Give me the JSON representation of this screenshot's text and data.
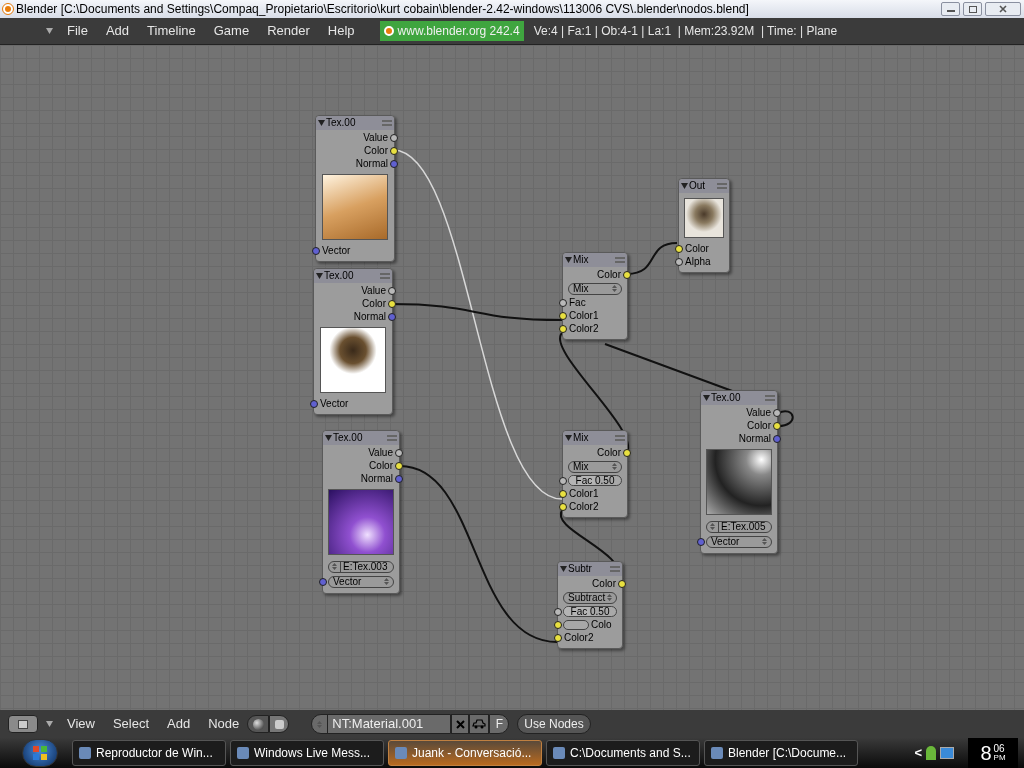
{
  "window": {
    "title": "Blender [C:\\Documents and Settings\\Compaq_Propietario\\Escritorio\\kurt cobain\\blender-2.42-windows\\113006 CVS\\.blender\\nodos.blend]"
  },
  "menu": [
    "File",
    "Add",
    "Timeline",
    "Game",
    "Render",
    "Help"
  ],
  "version_badge": "www.blender.org 242.4",
  "stats": "Ve:4 | Fa:1 | Ob:4-1 | La:1  | Mem:23.92M  | Time: | Plane",
  "nodes": [
    {
      "title": "Tex.00",
      "rows": [
        {
          "kind": "output",
          "label": "Value",
          "color": "#b8b8b8"
        },
        {
          "kind": "output",
          "label": "Color",
          "color": "#e8e040"
        },
        {
          "kind": "output",
          "label": "Normal",
          "color": "#6060d0"
        },
        {
          "kind": "preview"
        },
        {
          "kind": "input",
          "label": "Vector",
          "color": "#6060d0"
        }
      ]
    },
    {
      "title": "Out",
      "rows": [
        {
          "kind": "preview"
        },
        {
          "kind": "input",
          "label": "Color",
          "color": "#e8e040"
        },
        {
          "kind": "input",
          "label": "Alpha",
          "color": "#b8b8b8"
        }
      ]
    },
    {
      "title": "Mix",
      "rows": [
        {
          "kind": "output",
          "label": "Color",
          "color": "#e8e040"
        },
        {
          "kind": "dropdown",
          "label": "Mix"
        },
        {
          "kind": "input",
          "label": "Fac",
          "color": "#b8b8b8"
        },
        {
          "kind": "input",
          "label": "Color1",
          "color": "#e8e040"
        },
        {
          "kind": "input",
          "label": "Color2",
          "color": "#e8e040"
        }
      ]
    },
    {
      "title": "Tex.00",
      "rows": [
        {
          "kind": "output",
          "label": "Value",
          "color": "#b8b8b8"
        },
        {
          "kind": "output",
          "label": "Color",
          "color": "#e8e040"
        },
        {
          "kind": "output",
          "label": "Normal",
          "color": "#6060d0"
        },
        {
          "kind": "preview"
        },
        {
          "kind": "input",
          "label": "Vector",
          "color": "#6060d0"
        }
      ]
    },
    {
      "title": "Tex.00",
      "rows": [
        {
          "kind": "output",
          "label": "Value",
          "color": "#b8b8b8"
        },
        {
          "kind": "output",
          "label": "Color",
          "color": "#e8e040"
        },
        {
          "kind": "output",
          "label": "Normal",
          "color": "#6060d0"
        },
        {
          "kind": "preview"
        },
        {
          "kind": "texture",
          "label": "E:Tex.003"
        },
        {
          "kind": "dropdown",
          "label": "Vector",
          "color": "#6060d0"
        }
      ]
    },
    {
      "title": "Mix",
      "rows": [
        {
          "kind": "output",
          "label": "Color",
          "color": "#e8e040"
        },
        {
          "kind": "dropdown",
          "label": "Mix"
        },
        {
          "kind": "slider",
          "label": "Fac 0.50",
          "level": 0.5,
          "color": "#b8b8b8"
        },
        {
          "kind": "input",
          "label": "Color1",
          "color": "#e8e040"
        },
        {
          "kind": "input",
          "label": "Color2",
          "color": "#e8e040"
        }
      ]
    },
    {
      "title": "Tex.00",
      "rows": [
        {
          "kind": "output",
          "label": "Value",
          "color": "#b8b8b8"
        },
        {
          "kind": "output",
          "label": "Color",
          "color": "#e8e040"
        },
        {
          "kind": "output",
          "label": "Normal",
          "color": "#6060d0"
        },
        {
          "kind": "preview"
        },
        {
          "kind": "texture",
          "label": "E:Tex.005"
        },
        {
          "kind": "dropdown",
          "label": "Vector",
          "color": "#6060d0"
        }
      ]
    },
    {
      "title": "Subtr",
      "rows": [
        {
          "kind": "output",
          "label": "Color",
          "color": "#e8e040"
        },
        {
          "kind": "dropdown",
          "label": "Subtract"
        },
        {
          "kind": "slider",
          "label": "Fac 0.50",
          "level": 0.5,
          "color": "#b8b8b8"
        },
        {
          "kind": "swatch",
          "label": "Colo",
          "color": "#e8e040"
        },
        {
          "kind": "input",
          "label": "Color2",
          "color": "#e8e040"
        }
      ]
    }
  ],
  "node_header": {
    "menu": [
      "View",
      "Select",
      "Add",
      "Node"
    ],
    "material_field": "NT:Material.001",
    "fake_user": "F",
    "use_nodes": "Use Nodes"
  },
  "taskbar": {
    "items": [
      {
        "label": "Reproductor de Win...",
        "selected": false
      },
      {
        "label": "Windows Live Mess...",
        "selected": false
      },
      {
        "label": "Juank - Conversació...",
        "selected": true
      },
      {
        "label": "C:\\Documents and S...",
        "selected": false
      },
      {
        "label": "Blender [C:\\Docume...",
        "selected": false
      }
    ],
    "tray_expand": "<",
    "clock_hour": "8",
    "clock_minutes": "06",
    "clock_period": "PM"
  }
}
